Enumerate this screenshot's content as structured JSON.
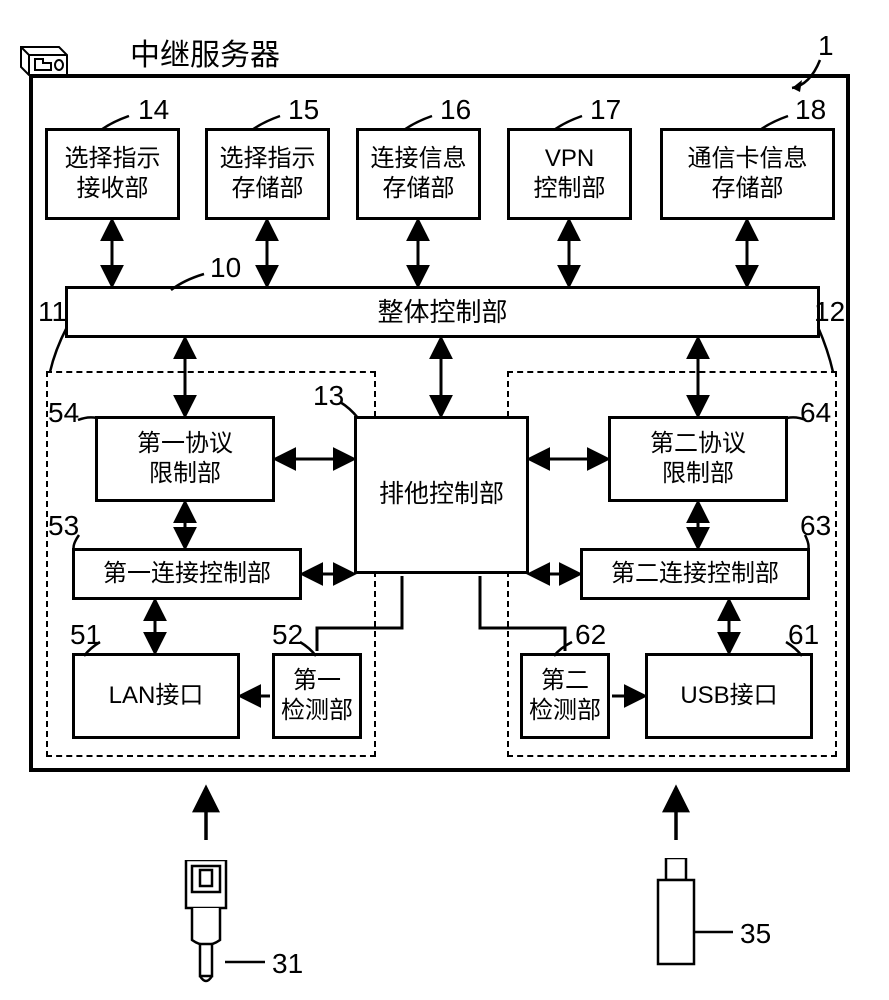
{
  "title": "中继服务器",
  "ref_numbers": {
    "device": "1",
    "overall_ctrl": "10",
    "group_left": "11",
    "group_right": "12",
    "exclusive_ctrl": "13",
    "top14": "14",
    "top15": "15",
    "top16": "16",
    "top17": "17",
    "top18": "18",
    "lan_port": "31",
    "usb_plug": "35",
    "lan_if": "51",
    "first_detect": "52",
    "first_conn_ctrl": "53",
    "first_proto_limit": "54",
    "usb_if": "61",
    "second_detect": "62",
    "second_conn_ctrl": "63",
    "second_proto_limit": "64"
  },
  "blocks": {
    "b14": "选择指示\n接收部",
    "b15": "选择指示\n存储部",
    "b16": "连接信息\n存储部",
    "b17": "VPN\n控制部",
    "b18": "通信卡信息\n存储部",
    "overall_ctrl": "整体控制部",
    "exclusive_ctrl": "排他控制部",
    "first_proto_limit": "第一协议\n限制部",
    "second_proto_limit": "第二协议\n限制部",
    "first_conn_ctrl": "第一连接控制部",
    "second_conn_ctrl": "第二连接控制部",
    "lan_if": "LAN接口",
    "usb_if": "USB接口",
    "first_detect": "第一\n检测部",
    "second_detect": "第二\n检测部"
  }
}
